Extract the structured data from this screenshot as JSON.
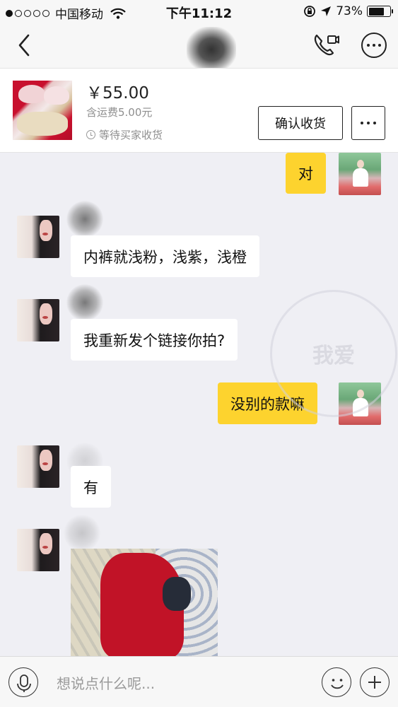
{
  "status_bar": {
    "carrier": "中国移动",
    "time": "下午11:12",
    "battery_percent": "73%",
    "battery_level": 0.73,
    "icons": [
      "signal-dots-icon",
      "wifi-icon",
      "orientation-lock-icon",
      "location-icon",
      "battery-icon"
    ]
  },
  "nav": {
    "back_icon": "chevron-left-icon",
    "call_icon": "phone-video-icon",
    "more_icon": "more-dots-icon"
  },
  "product": {
    "price": "￥55.00",
    "shipping": "含运费5.00元",
    "status": "等待买家收货",
    "confirm_label": "确认收货"
  },
  "messages": [
    {
      "from": "me",
      "text": "对"
    },
    {
      "from": "her",
      "text": "内裤就浅粉，浅紫，浅橙"
    },
    {
      "from": "her",
      "text": "我重新发个链接你拍?"
    },
    {
      "from": "me",
      "text": "没别的款嘛"
    },
    {
      "from": "her",
      "text": "有"
    },
    {
      "from": "her",
      "type": "image"
    }
  ],
  "watermark": "我爱",
  "input": {
    "placeholder": "想说点什么呢..."
  }
}
